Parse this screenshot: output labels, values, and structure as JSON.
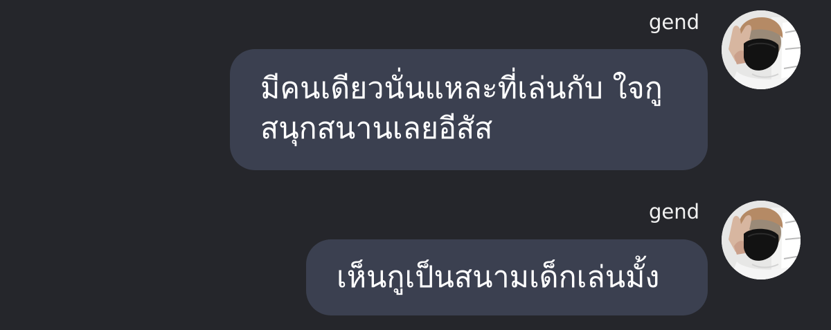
{
  "messages": [
    {
      "sender": "gend",
      "text": "มีคนเดียวนั่นแหละที่เล่นกับ ใจกู\nสนุกสนานเลยอีสัส",
      "avatar": "profile-photo"
    },
    {
      "sender": "gend",
      "text": "เห็นกูเป็นสนามเด็กเล่นมั้ง",
      "avatar": "profile-photo"
    }
  ],
  "colors": {
    "background": "#25262b",
    "bubble": "#3b4050",
    "text": "#ffffff",
    "sender_name": "#f2f2f2"
  }
}
